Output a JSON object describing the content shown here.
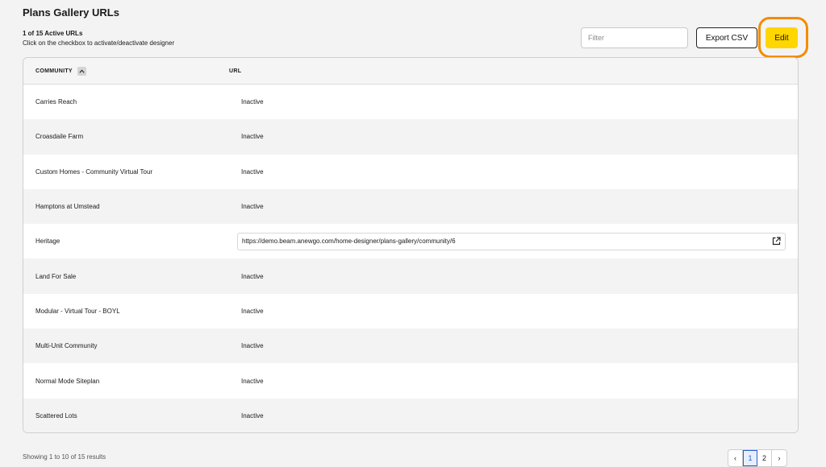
{
  "page": {
    "title": "Plans Gallery URLs",
    "summary": "1 of 15 Active URLs",
    "hint": "Click on the checkbox to activate/deactivate designer"
  },
  "toolbar": {
    "filter_placeholder": "Filter",
    "export_label": "Export CSV",
    "edit_label": "Edit"
  },
  "table": {
    "headers": {
      "community": "COMMUNITY",
      "url": "URL"
    },
    "rows": [
      {
        "community": "Carries Reach",
        "url": "Inactive"
      },
      {
        "community": "Croasdaile Farm",
        "url": "Inactive"
      },
      {
        "community": "Custom Homes - Community Virtual Tour",
        "url": "Inactive"
      },
      {
        "community": "Hamptons at Umstead",
        "url": "Inactive"
      },
      {
        "community": "Heritage",
        "url": "https://demo.beam.anewgo.com/home-designer/plans-gallery/community/6"
      },
      {
        "community": "Land For Sale",
        "url": "Inactive"
      },
      {
        "community": "Modular - Virtual Tour - BOYL",
        "url": "Inactive"
      },
      {
        "community": "Multi-Unit Community",
        "url": "Inactive"
      },
      {
        "community": "Normal Mode Siteplan",
        "url": "Inactive"
      },
      {
        "community": "Scattered Lots",
        "url": "Inactive"
      }
    ]
  },
  "footer": {
    "results_text": "Showing 1 to 10 of 15 results",
    "pages": [
      "‹",
      "1",
      "2",
      "›"
    ],
    "current_page": "1"
  },
  "colors": {
    "accent": "#ffd600",
    "highlight_ring": "#f28c00"
  }
}
